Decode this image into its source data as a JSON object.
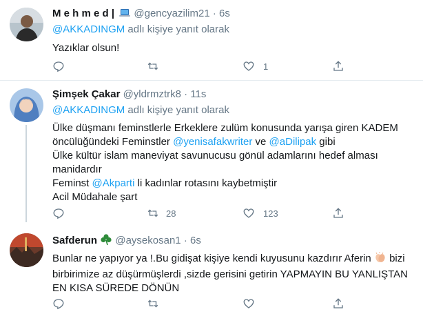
{
  "tweets": [
    {
      "name": "M e h m e d |",
      "handle": "@gencyazilim21",
      "time": "6s",
      "reply_prefix": "",
      "reply_mention": "@AKKADINGM",
      "reply_suffix": "adlı kişiye yanıt olarak",
      "body": [
        "Yazıklar olsun!"
      ],
      "retweets": "",
      "likes": "1"
    },
    {
      "name": "Şimşek Çakar",
      "handle": "@yldrmztrk8",
      "time": "11s",
      "reply_mention": "@AKKADINGM",
      "reply_suffix": "adlı kişiye yanıt olarak",
      "body_line1": "Ülke düşmanı feminstlerle Erkeklere zulüm konusunda yarışa giren KADEM",
      "body_line2a": "öncülüğündeki Feminstler ",
      "body_line2_m1": "@yenisafakwriter",
      "body_line2b": " ve ",
      "body_line2_m2": "@aDilipak",
      "body_line2c": " gibi",
      "body_line3": "Ülke kültür islam maneviyat savunucusu gönül adamlarını hedef alması",
      "body_line4": "manidardır",
      "body_line5a": "Feminst ",
      "body_line5_m": "@Akparti",
      "body_line5b": " li kadınlar rotasını kaybetmiştir",
      "body_line6": "Acil Müdahale şart",
      "retweets": "28",
      "likes": "123"
    },
    {
      "name": "Safderun",
      "handle": "@aysekosan1",
      "time": "6s",
      "body_line1": "Bunlar ne yapıyor ya !.Bu gidişat kişiye kendi kuyusunu kazdırır Aferin",
      "body_line1b": "bizi",
      "body_line2": "birbirimize az düşürmüşlerdi ,sizde gerisini getirin YAPMAYIN BU YANLIŞTAN",
      "body_line3": "EN KISA SÜREDE DÖNÜN"
    }
  ],
  "separator": "·",
  "colors": {
    "accent": "#1da1f2",
    "muted": "#657786",
    "text": "#14171a"
  }
}
